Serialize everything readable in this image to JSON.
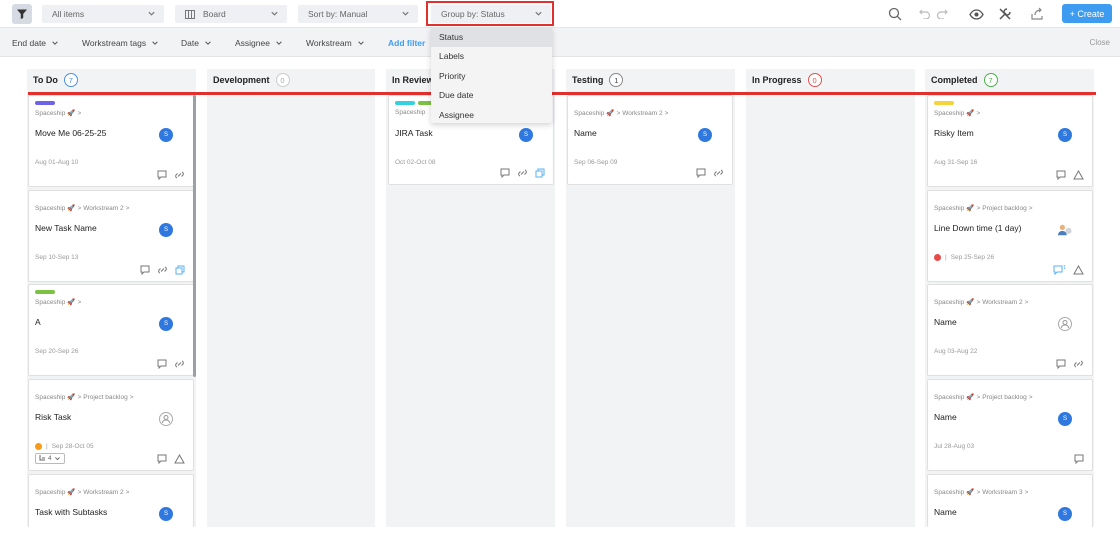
{
  "toolbar": {
    "items_select": "All items",
    "view_select": "Board",
    "sort_select": "Sort by: Manual",
    "group_select": "Group by: Status",
    "create_label": "+ Create"
  },
  "filters": {
    "items": [
      "End date",
      "Workstream tags",
      "Date",
      "Assignee",
      "Workstream"
    ],
    "add_filter": "Add filter",
    "close": "Close"
  },
  "group_menu": {
    "options": [
      "Status",
      "Labels",
      "Priority",
      "Due date",
      "Assignee"
    ],
    "selected": "Status"
  },
  "columns": [
    {
      "title": "To Do",
      "count": "7"
    },
    {
      "title": "Development",
      "count": "0"
    },
    {
      "title": "In Review",
      "count": ""
    },
    {
      "title": "Testing",
      "count": "1"
    },
    {
      "title": "In Progress",
      "count": "0"
    },
    {
      "title": "Completed",
      "count": "7"
    }
  ],
  "cards": {
    "todo": [
      {
        "crumb": "Spaceship",
        "crumb2": "",
        "title": "Move Me 06-25-25",
        "avatar": "S",
        "dates": "Aug 01-Aug 10"
      },
      {
        "crumb": "Spaceship",
        "crumb2": "Workstream 2",
        "title": "New Task Name",
        "avatar": "S",
        "dates": "Sep 10-Sep 13"
      },
      {
        "crumb": "Spaceship",
        "crumb2": "",
        "title": "A",
        "avatar": "S",
        "dates": "Sep 20-Sep 26"
      },
      {
        "crumb": "Spaceship",
        "crumb2": "Project backlog",
        "title": "Risk Task",
        "avatar": "",
        "dates": "Sep 28-Oct 05",
        "subtasks": "4"
      },
      {
        "crumb": "Spaceship",
        "crumb2": "Workstream 2",
        "title": "Task with Subtasks",
        "avatar": "S"
      }
    ],
    "review": [
      {
        "crumb": "Spaceship",
        "title": "JIRA Task",
        "avatar": "S",
        "dates": "Oct 02-Oct 08"
      }
    ],
    "testing": [
      {
        "crumb": "Spaceship",
        "crumb2": "Workstream 2",
        "title": "Name",
        "avatar": "S",
        "dates": "Sep 06-Sep 09"
      }
    ],
    "completed": [
      {
        "crumb": "Spaceship",
        "crumb2": "",
        "title": "Risky Item",
        "avatar": "S",
        "dates": "Aug 31-Sep 16"
      },
      {
        "crumb": "Spaceship",
        "crumb2": "Project backlog",
        "title": "Line Down time (1 day)",
        "avatar": "",
        "dates": "Sep 25-Sep 26",
        "comment_count": "1"
      },
      {
        "crumb": "Spaceship",
        "crumb2": "Workstream 2",
        "title": "Name",
        "avatar": "",
        "dates": "Aug 03-Aug 22"
      },
      {
        "crumb": "Spaceship",
        "crumb2": "Project backlog",
        "title": "Name",
        "avatar": "S",
        "dates": "Jul 28-Aug 03"
      },
      {
        "crumb": "Spaceship",
        "crumb2": "Workstream 3",
        "title": "Name",
        "avatar": "S"
      }
    ]
  },
  "colors": {
    "accent": "#3e9cf0",
    "highlight": "#e0312f",
    "avatar": "#2f78e0",
    "tag_purple": "#6c63e8",
    "tag_green": "#7cc242",
    "tag_cyan": "#34d1e0",
    "tag_yellow": "#f5d33b",
    "risk_orange": "#f59a1b",
    "risk_red": "#e84a4a"
  }
}
